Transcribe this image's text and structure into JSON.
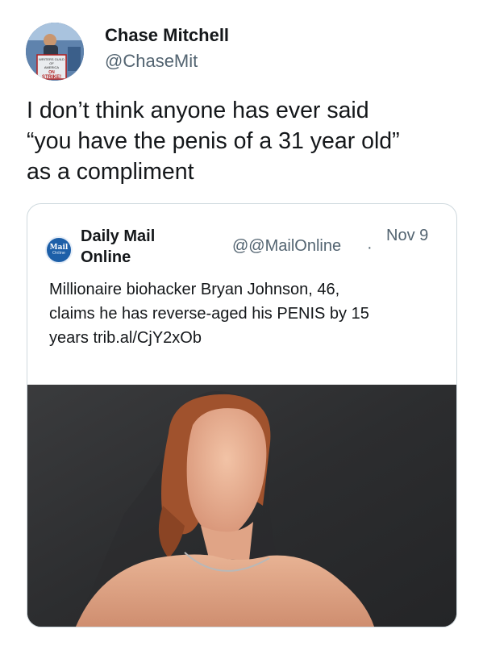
{
  "tweet": {
    "author_name": "Chase Mitchell",
    "author_handle": "@ChaseMit",
    "avatar_icon": "profile-photo-icon",
    "avatar_sign_lines": [
      "WRITERS GUILD",
      "OF",
      "AMERICA",
      "ON",
      "STRIKE!"
    ],
    "text_lines": [
      "I don’t think anyone has ever said",
      "“you have the penis of a 31 year old”",
      "as a compliment"
    ]
  },
  "quoted_tweet": {
    "author_name_lines": [
      "Daily Mail",
      "Online"
    ],
    "author_handle": "@@MailOnline",
    "separator": "·",
    "date": "Nov 9",
    "avatar_icon": "daily-mail-logo-icon",
    "avatar_logo_lines": [
      "Mail",
      "Online"
    ],
    "text_lines": [
      "Millionaire biohacker Bryan Johnson, 46,",
      "claims he has reverse-aged his PENIS by 15",
      "years trib.al/CjY2xOb"
    ],
    "media_icon": "article-photo-icon"
  },
  "colors": {
    "text_primary": "#14171a",
    "text_secondary": "#536471",
    "card_border": "#cfd9de",
    "mail_blue": "#1d5fa8"
  }
}
